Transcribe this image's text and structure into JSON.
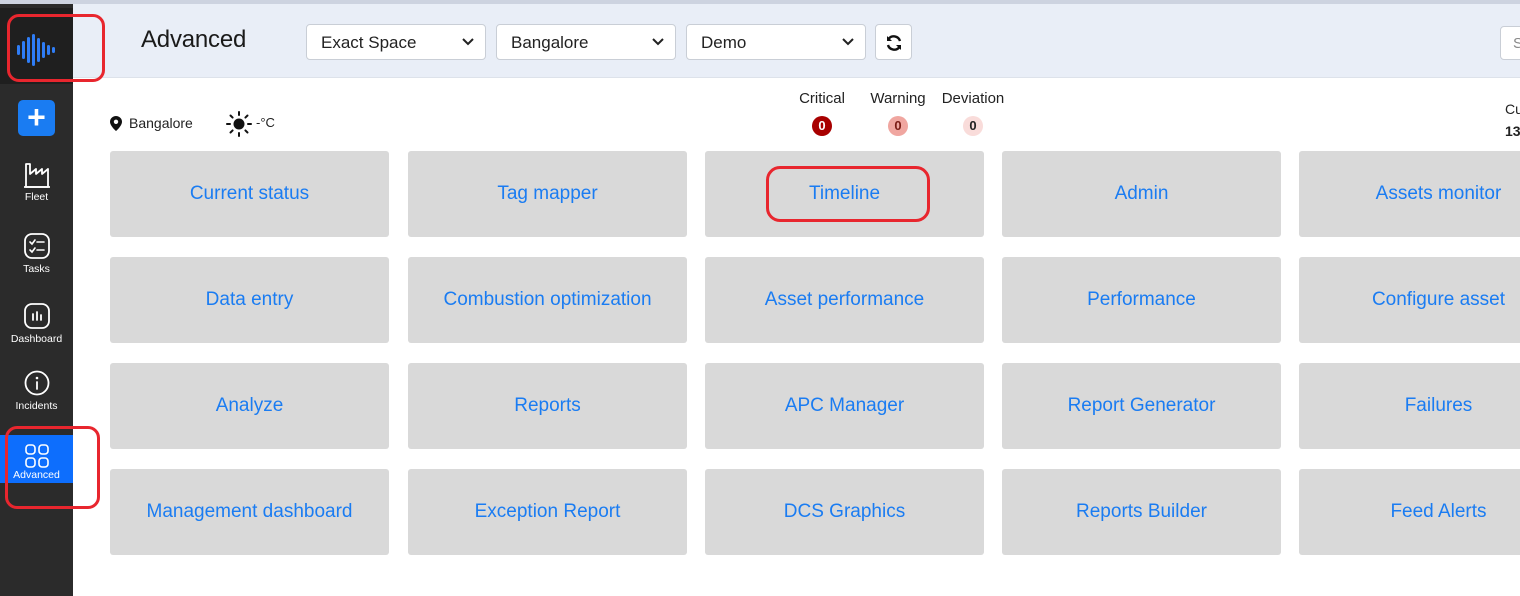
{
  "sidebar": {
    "items": [
      {
        "label": "Fleet",
        "icon": "factory-icon"
      },
      {
        "label": "Tasks",
        "icon": "checklist-icon"
      },
      {
        "label": "Dashboard",
        "icon": "dashboard-icon"
      },
      {
        "label": "Incidents",
        "icon": "info-icon"
      },
      {
        "label": "Advanced",
        "icon": "grid-icon",
        "active": true
      }
    ],
    "add_label": "+"
  },
  "header": {
    "title": "Advanced",
    "selects": [
      {
        "value": "Exact Space"
      },
      {
        "value": "Bangalore"
      },
      {
        "value": "Demo"
      }
    ],
    "search_stub": "S"
  },
  "info": {
    "location": "Bangalore",
    "temperature": "-°C",
    "counters": [
      {
        "name": "Critical",
        "count": "0",
        "bg": "#a80000",
        "fg": "#ffffff"
      },
      {
        "name": "Warning",
        "count": "0",
        "bg": "#f0a6a0",
        "fg": "#7a1b14"
      },
      {
        "name": "Deviation",
        "count": "0",
        "bg": "#f9dcda",
        "fg": "#222222"
      }
    ],
    "cu_label": "Cu",
    "cu_value": "13"
  },
  "tiles": [
    [
      "Current status",
      "Tag mapper",
      "Timeline",
      "Admin",
      "Assets monitor"
    ],
    [
      "Data entry",
      "Combustion optimization",
      "Asset performance",
      "Performance",
      "Configure asset"
    ],
    [
      "Analyze",
      "Reports",
      "APC Manager",
      "Report Generator",
      "Failures"
    ],
    [
      "Management dashboard",
      "Exception Report",
      "DCS Graphics",
      "Reports Builder",
      "Feed Alerts"
    ]
  ],
  "colors": {
    "accent": "#1a7cf2",
    "sidebar": "#2b2b2b",
    "tile_bg": "#d9d9d9",
    "annotation": "#e8262e"
  }
}
